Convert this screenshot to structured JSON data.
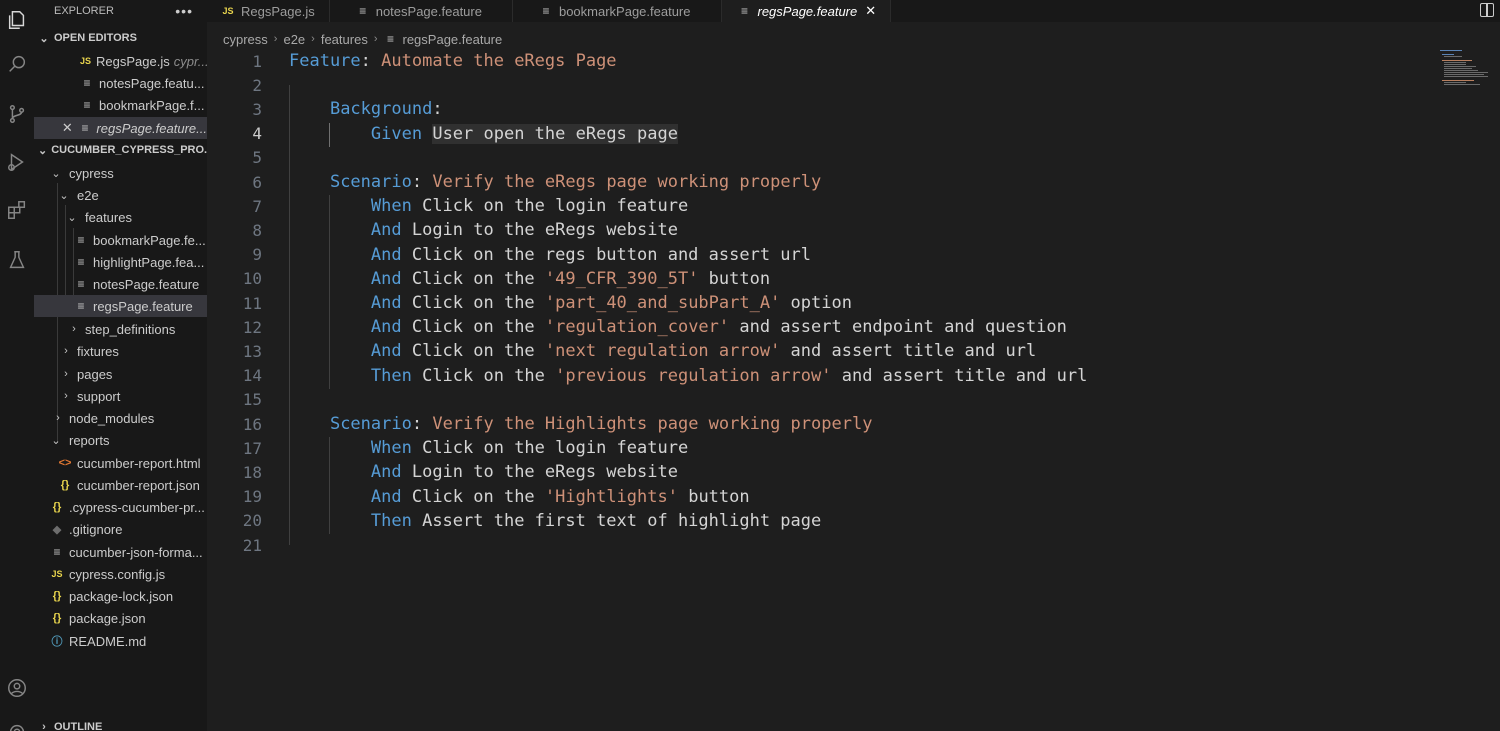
{
  "activity_bar": {
    "icons": [
      "explorer-icon",
      "search-icon",
      "source-control-icon",
      "run-debug-icon",
      "extensions-icon",
      "testing-icon",
      "account-icon",
      "settings-icon"
    ]
  },
  "sidebar": {
    "title": "EXPLORER",
    "more_label": "•••",
    "open_editors_label": "OPEN EDITORS",
    "open_editors": [
      {
        "name": "RegsPage.js",
        "detail": "cypr..."
      },
      {
        "name": "notesPage.featu..."
      },
      {
        "name": "bookmarkPage.f..."
      },
      {
        "name": "regsPage.feature..."
      }
    ],
    "project_label": "CUCUMBER_CYPRESS_PRO...",
    "tree": {
      "cypress": "cypress",
      "e2e": "e2e",
      "features": "features",
      "feature_files": [
        "bookmarkPage.fe...",
        "highlightPage.fea...",
        "notesPage.feature",
        "regsPage.feature"
      ],
      "step_definitions": "step_definitions",
      "fixtures": "fixtures",
      "pages": "pages",
      "support": "support",
      "node_modules": "node_modules",
      "reports": "reports",
      "report_files": [
        "cucumber-report.html",
        "cucumber-report.json"
      ],
      "root_files": [
        ".cypress-cucumber-pr...",
        ".gitignore",
        "cucumber-json-forma...",
        "cypress.config.js",
        "package-lock.json",
        "package.json",
        "README.md"
      ]
    },
    "outline_label": "OUTLINE"
  },
  "tabs": [
    {
      "label": "RegsPage.js",
      "icon": "JS"
    },
    {
      "label": "notesPage.feature",
      "icon": "≡"
    },
    {
      "label": "bookmarkPage.feature",
      "icon": "≡"
    },
    {
      "label": "regsPage.feature",
      "icon": "≡",
      "active": true
    }
  ],
  "tab_close": "✕",
  "breadcrumb": [
    "cypress",
    "e2e",
    "features",
    "regsPage.feature"
  ],
  "editor": {
    "current_line": 4,
    "lines": [
      [
        {
          "t": "Feature",
          "c": "kw"
        },
        {
          "t": ":",
          "c": "plain"
        },
        {
          "t": " Automate the eRegs Page",
          "c": "title"
        }
      ],
      [],
      [
        {
          "t": "    "
        },
        {
          "t": "Background",
          "c": "kw"
        },
        {
          "t": ":",
          "c": "plain"
        }
      ],
      [
        {
          "t": "        "
        },
        {
          "t": "Given",
          "c": "kw"
        },
        {
          "t": " "
        },
        {
          "t": "User open the eRegs page",
          "c": "plain sel"
        }
      ],
      [],
      [
        {
          "t": "    "
        },
        {
          "t": "Scenario",
          "c": "kw"
        },
        {
          "t": ":",
          "c": "plain"
        },
        {
          "t": " Verify the eRegs page working properly",
          "c": "title"
        }
      ],
      [
        {
          "t": "        "
        },
        {
          "t": "When",
          "c": "kw"
        },
        {
          "t": " Click on the login feature",
          "c": "plain"
        }
      ],
      [
        {
          "t": "        "
        },
        {
          "t": "And",
          "c": "kw"
        },
        {
          "t": " Login to the eRegs website",
          "c": "plain"
        }
      ],
      [
        {
          "t": "        "
        },
        {
          "t": "And",
          "c": "kw"
        },
        {
          "t": " Click on the regs button and assert url",
          "c": "plain"
        }
      ],
      [
        {
          "t": "        "
        },
        {
          "t": "And",
          "c": "kw"
        },
        {
          "t": " Click on the ",
          "c": "plain"
        },
        {
          "t": "'49_CFR_390_5T'",
          "c": "str"
        },
        {
          "t": " button",
          "c": "plain"
        }
      ],
      [
        {
          "t": "        "
        },
        {
          "t": "And",
          "c": "kw"
        },
        {
          "t": " Click on the ",
          "c": "plain"
        },
        {
          "t": "'part_40_and_subPart_A'",
          "c": "str"
        },
        {
          "t": " option",
          "c": "plain"
        }
      ],
      [
        {
          "t": "        "
        },
        {
          "t": "And",
          "c": "kw"
        },
        {
          "t": " Click on the ",
          "c": "plain"
        },
        {
          "t": "'regulation_cover'",
          "c": "str"
        },
        {
          "t": " and assert endpoint and question",
          "c": "plain"
        }
      ],
      [
        {
          "t": "        "
        },
        {
          "t": "And",
          "c": "kw"
        },
        {
          "t": " Click on the ",
          "c": "plain"
        },
        {
          "t": "'next regulation arrow'",
          "c": "str"
        },
        {
          "t": " and assert title and url",
          "c": "plain"
        }
      ],
      [
        {
          "t": "        "
        },
        {
          "t": "Then",
          "c": "kw"
        },
        {
          "t": " Click on the ",
          "c": "plain"
        },
        {
          "t": "'previous regulation arrow'",
          "c": "str"
        },
        {
          "t": " and assert title and url",
          "c": "plain"
        }
      ],
      [],
      [
        {
          "t": "    "
        },
        {
          "t": "Scenario",
          "c": "kw"
        },
        {
          "t": ":",
          "c": "plain"
        },
        {
          "t": " Verify the Highlights page working properly",
          "c": "title"
        }
      ],
      [
        {
          "t": "        "
        },
        {
          "t": "When",
          "c": "kw"
        },
        {
          "t": " Click on the login feature",
          "c": "plain"
        }
      ],
      [
        {
          "t": "        "
        },
        {
          "t": "And",
          "c": "kw"
        },
        {
          "t": " Login to the eRegs website",
          "c": "plain"
        }
      ],
      [
        {
          "t": "        "
        },
        {
          "t": "And",
          "c": "kw"
        },
        {
          "t": " Click on the ",
          "c": "plain"
        },
        {
          "t": "'Hightlights'",
          "c": "str"
        },
        {
          "t": " button",
          "c": "plain"
        }
      ],
      [
        {
          "t": "        "
        },
        {
          "t": "Then",
          "c": "kw"
        },
        {
          "t": " Assert the first text of highlight page",
          "c": "plain"
        }
      ],
      []
    ]
  }
}
